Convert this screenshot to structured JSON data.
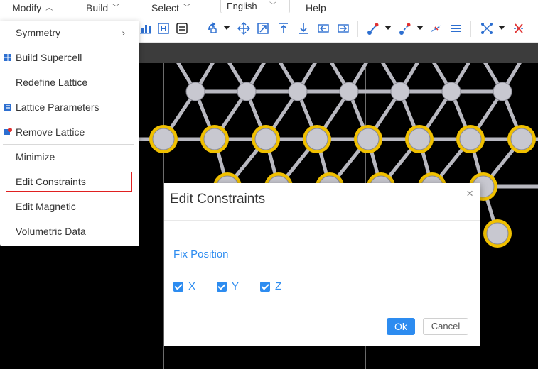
{
  "menubar": {
    "items": [
      {
        "label": "Modify",
        "chevron": "up"
      },
      {
        "label": "Build",
        "chevron": "down"
      },
      {
        "label": "Select",
        "chevron": "down"
      },
      {
        "label": "Help"
      }
    ],
    "language": {
      "value": "English"
    }
  },
  "dropdown": {
    "items": [
      {
        "label": "Symmetry",
        "submenu_arrow": "›"
      },
      {
        "label": "Build Supercell",
        "icon": "supercell-icon"
      },
      {
        "label": "Redefine Lattice"
      },
      {
        "label": "Lattice Parameters",
        "icon": "lattice-parameters-icon"
      },
      {
        "label": "Remove Lattice",
        "icon": "remove-lattice-icon"
      },
      {
        "label": "Minimize"
      },
      {
        "label": "Edit Constraints",
        "highlighted": true
      },
      {
        "label": "Edit Magnetic"
      },
      {
        "label": "Volumetric Data"
      }
    ]
  },
  "toolbar": {
    "icons": [
      "bar-chart-icon",
      "h-lattice-icon",
      "panel-icon",
      "rotate-hand-icon",
      "move-icon",
      "expand-icon",
      "arrow-up-icon",
      "arrow-down-icon",
      "arrow-left-icon",
      "arrow-right-icon",
      "bond-icon",
      "bond-length-icon",
      "measure-icon",
      "layers-icon",
      "select-box-icon",
      "delete-icon"
    ]
  },
  "modal": {
    "title": "Edit Constraints",
    "close_symbol": "×",
    "section_title": "Fix Position",
    "checkboxes": [
      {
        "label": "X",
        "checked": true
      },
      {
        "label": "Y",
        "checked": true
      },
      {
        "label": "Z",
        "checked": true
      }
    ],
    "ok_label": "Ok",
    "cancel_label": "Cancel"
  },
  "colors": {
    "accent": "#2d8cf0",
    "highlight_border": "#e02020",
    "atom": "#c8c8d0",
    "atom_selected_ring": "#f0c000",
    "viewer_bg": "#000000"
  }
}
